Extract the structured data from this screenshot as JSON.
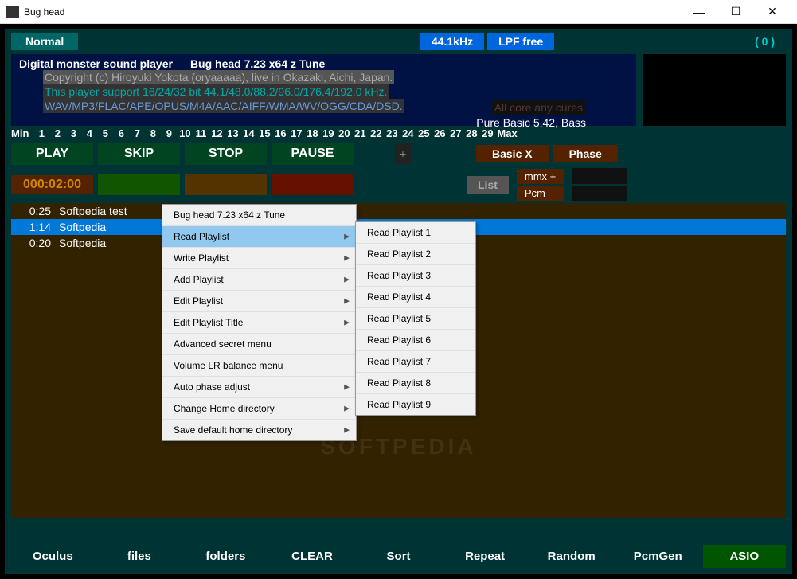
{
  "titlebar": {
    "title": "Bug head"
  },
  "topbar": {
    "normal": "Normal",
    "khz": "44.1kHz",
    "lpf": "LPF free",
    "count": "( 0 )"
  },
  "info": {
    "line1a": "Digital monster sound player",
    "line1b": "Bug head  7.23 x64   z Tune",
    "line2": "Copyright (c) Hiroyuki Yokota (oryaaaaa), live in Okazaki, Aichi, Japan.",
    "line3": "This player support 16/24/32 bit  44.1/48.0/88.2/96.0/176.4/192.0 kHz.",
    "line4": "WAV/MP3/FLAC/APE/OPUS/M4A/AAC/AIFF/WMA/WV/OGG/CDA/DSD.",
    "cores": "All core any cures",
    "basic": "Pure Basic 5.42, Bass"
  },
  "numbers": {
    "min": "Min",
    "items": [
      "1",
      "2",
      "3",
      "4",
      "5",
      "6",
      "7",
      "8",
      "9",
      "10",
      "11",
      "12",
      "13",
      "14",
      "15",
      "16",
      "17",
      "18",
      "19",
      "20",
      "21",
      "22",
      "23",
      "24",
      "25",
      "26",
      "27",
      "28",
      "29"
    ],
    "max": "Max"
  },
  "controls": {
    "play": "PLAY",
    "skip": "SKIP",
    "stop": "STOP",
    "pause": "PAUSE",
    "plus": "+",
    "basicx": "Basic X",
    "phase": "Phase"
  },
  "status": {
    "time": "000:02:00",
    "list": "List",
    "mmx": "mmx +",
    "pcm": "Pcm"
  },
  "playlist": [
    {
      "time": "0:25",
      "name": "Softpedia test"
    },
    {
      "time": "1:14",
      "name": "Softpedia"
    },
    {
      "time": "0:20",
      "name": "Softpedia"
    }
  ],
  "contextMenu": {
    "title": "Bug head 7.23 x64   z Tune",
    "items": [
      {
        "label": "Read Playlist",
        "arrow": true,
        "hl": true
      },
      {
        "label": "Write Playlist",
        "arrow": true
      },
      {
        "label": "Add Playlist",
        "arrow": true
      },
      {
        "label": "Edit Playlist",
        "arrow": true
      },
      {
        "label": "Edit Playlist Title",
        "arrow": true
      },
      {
        "label": "Advanced secret menu",
        "arrow": false
      },
      {
        "label": "Volume LR balance menu",
        "arrow": false
      },
      {
        "label": "Auto phase adjust",
        "arrow": true
      },
      {
        "label": "Change Home directory",
        "arrow": true
      },
      {
        "label": "Save default home directory",
        "arrow": true
      }
    ]
  },
  "submenu": [
    "Read Playlist 1",
    "Read Playlist 2",
    "Read Playlist 3",
    "Read Playlist 4",
    "Read Playlist 5",
    "Read Playlist 6",
    "Read Playlist 7",
    "Read Playlist 8",
    "Read Playlist 9"
  ],
  "bottom": {
    "oculus": "Oculus",
    "files": "files",
    "folders": "folders",
    "clear": "CLEAR",
    "sort": "Sort",
    "repeat": "Repeat",
    "random": "Random",
    "pcmgen": "PcmGen",
    "asio": "ASIO"
  },
  "watermark": "SOFTPEDIA"
}
